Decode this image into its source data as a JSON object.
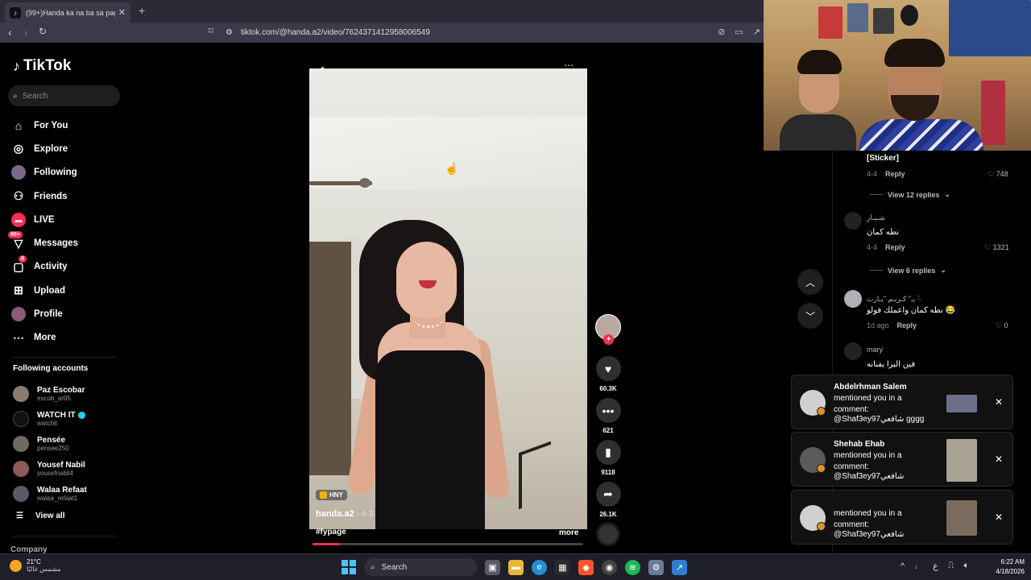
{
  "browser": {
    "tab_title": "(99+)Handa ka na ba sa pagp",
    "tab_close": "✕",
    "new_tab": "+",
    "url": "tiktok.com/@handa.a2/video/7624371412958006549"
  },
  "sidebar": {
    "logo": "TikTok",
    "search_placeholder": "Search",
    "nav": [
      {
        "label": "For You",
        "icon": "home-icon"
      },
      {
        "label": "Explore",
        "icon": "compass-icon"
      },
      {
        "label": "Following",
        "icon": "following-avatar-icon"
      },
      {
        "label": "Friends",
        "icon": "friends-icon"
      },
      {
        "label": "LIVE",
        "icon": "live-icon"
      },
      {
        "label": "Messages",
        "icon": "messages-icon",
        "badge": "99+"
      },
      {
        "label": "Activity",
        "icon": "activity-icon",
        "badge": "8"
      },
      {
        "label": "Upload",
        "icon": "upload-icon"
      },
      {
        "label": "Profile",
        "icon": "profile-avatar-icon"
      },
      {
        "label": "More",
        "icon": "more-icon"
      }
    ],
    "following_title": "Following accounts",
    "accounts": [
      {
        "name": "Paz Escobar",
        "username": "escob_ar05",
        "verified": false
      },
      {
        "name": "WATCH IT",
        "username": "watchit",
        "verified": true
      },
      {
        "name": "Pensée",
        "username": "pensee250",
        "verified": false
      },
      {
        "name": "Yousef Nabil",
        "username": "yousefnabil4",
        "verified": false
      },
      {
        "name": "Walaa Refaat",
        "username": "walaa_refaat1",
        "verified": false
      }
    ],
    "view_all": "View all",
    "company": "Company"
  },
  "video": {
    "tag": "HNY",
    "author": "handa.a2",
    "date": "· 4-3",
    "hashtag": "#fypage",
    "more": "more",
    "progress": 0.1,
    "likes": "60.3K",
    "comments": "621",
    "saves": "9118",
    "shares": "26.1K"
  },
  "comments": [
    {
      "name": "",
      "text": "[Sticker]",
      "date": "4-4",
      "reply": "Reply",
      "likes": "748",
      "replies": "View 12 replies"
    },
    {
      "name": "شـيـار",
      "text": "نطه كمان",
      "date": "4-4",
      "reply": "Reply",
      "likes": "1321",
      "replies": "View 6 replies"
    },
    {
      "name": "يـ\" كـريـم \"يـارت 𓆩",
      "text": "نطه كمان واعملك فولو 😂",
      "date": "1d ago",
      "reply": "Reply",
      "likes": "0",
      "replies": ""
    },
    {
      "name": "mary",
      "text": "فين البرا يفنانه",
      "date": "",
      "reply": "",
      "likes": "",
      "replies": ""
    }
  ],
  "notifications": [
    {
      "name": "Abdelrhman Salem",
      "line1": "mentioned you in a",
      "line2": "comment:",
      "line3": "@Shaf3ey97شافعي gggg"
    },
    {
      "name": "Shehab Ehab",
      "line1": "mentioned you in a",
      "line2": "comment:",
      "line3": "@Shaf3ey97شافعي"
    },
    {
      "name": "",
      "line1": "mentioned you in a",
      "line2": "comment:",
      "line3": "@Shaf3ey97شافعي"
    }
  ],
  "taskbar": {
    "temperature": "21°C",
    "condition": "مشمس غالبًا",
    "search": "Search",
    "time": "6:22 AM",
    "date": "4/18/2026",
    "lang": "ع"
  },
  "colors": {
    "accent": "#fe2c55",
    "tiktok_cyan": "#20d5ec"
  }
}
